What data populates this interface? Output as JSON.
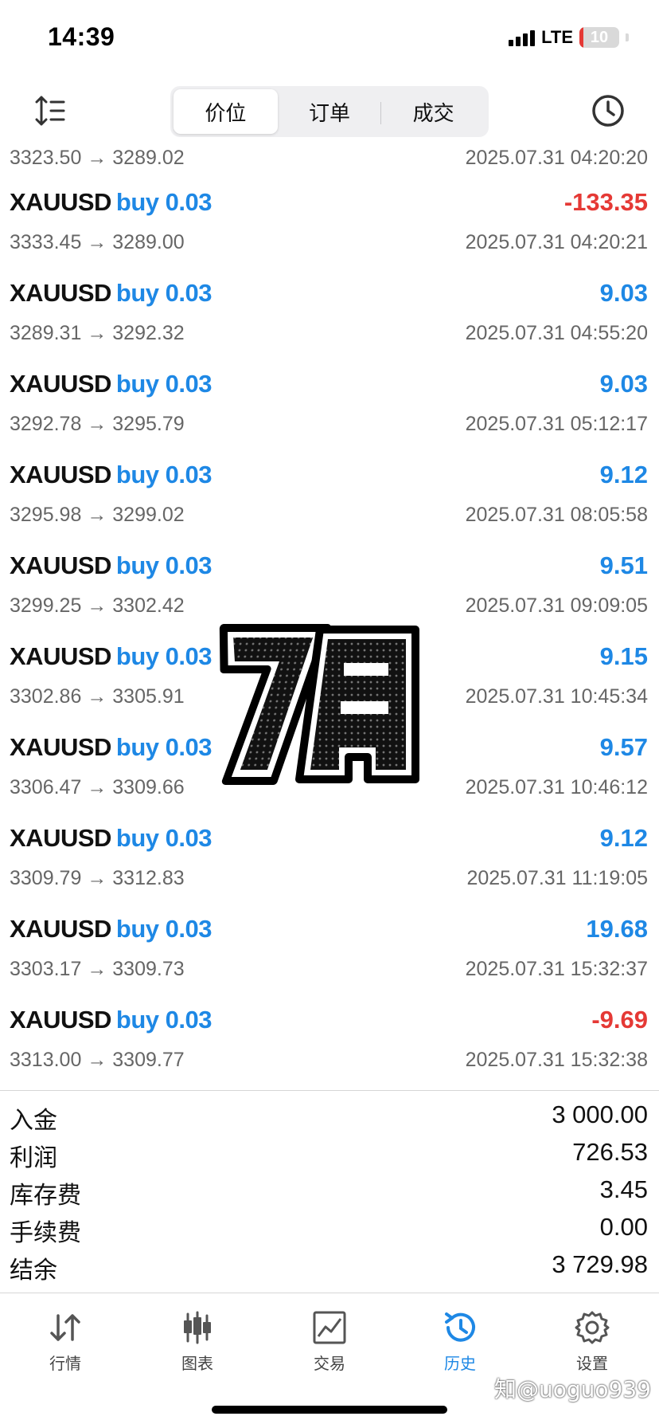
{
  "status": {
    "time": "14:39",
    "network": "LTE",
    "battery": "10"
  },
  "header": {
    "tabs": [
      {
        "label": "价位",
        "active": true
      },
      {
        "label": "订单",
        "active": false
      },
      {
        "label": "成交",
        "active": false
      }
    ]
  },
  "partial_row": {
    "prices": "3323.50 → 3289.02",
    "time": "2025.07.31 04:20:20"
  },
  "deals": [
    {
      "symbol": "XAUUSD",
      "side": "buy 0.03",
      "profit": "-133.35",
      "prices": "3333.45 → 3289.00",
      "time": "2025.07.31 04:20:21"
    },
    {
      "symbol": "XAUUSD",
      "side": "buy 0.03",
      "profit": "9.03",
      "prices": "3289.31 → 3292.32",
      "time": "2025.07.31 04:55:20"
    },
    {
      "symbol": "XAUUSD",
      "side": "buy 0.03",
      "profit": "9.03",
      "prices": "3292.78 → 3295.79",
      "time": "2025.07.31 05:12:17"
    },
    {
      "symbol": "XAUUSD",
      "side": "buy 0.03",
      "profit": "9.12",
      "prices": "3295.98 → 3299.02",
      "time": "2025.07.31 08:05:58"
    },
    {
      "symbol": "XAUUSD",
      "side": "buy 0.03",
      "profit": "9.51",
      "prices": "3299.25 → 3302.42",
      "time": "2025.07.31 09:09:05"
    },
    {
      "symbol": "XAUUSD",
      "side": "buy 0.03",
      "profit": "9.15",
      "prices": "3302.86 → 3305.91",
      "time": "2025.07.31 10:45:34"
    },
    {
      "symbol": "XAUUSD",
      "side": "buy 0.03",
      "profit": "9.57",
      "prices": "3306.47 → 3309.66",
      "time": "2025.07.31 10:46:12"
    },
    {
      "symbol": "XAUUSD",
      "side": "buy 0.03",
      "profit": "9.12",
      "prices": "3309.79 → 3312.83",
      "time": "2025.07.31 11:19:05"
    },
    {
      "symbol": "XAUUSD",
      "side": "buy 0.03",
      "profit": "19.68",
      "prices": "3303.17 → 3309.73",
      "time": "2025.07.31 15:32:37"
    },
    {
      "symbol": "XAUUSD",
      "side": "buy 0.03",
      "profit": "-9.69",
      "prices": "3313.00 → 3309.77",
      "time": "2025.07.31 15:32:38"
    }
  ],
  "summary": [
    {
      "label": "入金",
      "value": "3 000.00"
    },
    {
      "label": "利润",
      "value": "726.53"
    },
    {
      "label": "库存费",
      "value": "3.45"
    },
    {
      "label": "手续费",
      "value": "0.00"
    },
    {
      "label": "结余",
      "value": "3 729.98"
    }
  ],
  "sticker_text": "7月",
  "tabbar": [
    {
      "label": "行情",
      "icon": "quotes-arrows-icon",
      "active": false
    },
    {
      "label": "图表",
      "icon": "candlestick-chart-icon",
      "active": false
    },
    {
      "label": "交易",
      "icon": "trade-chart-icon",
      "active": false
    },
    {
      "label": "历史",
      "icon": "history-clock-icon",
      "active": true
    },
    {
      "label": "设置",
      "icon": "settings-gear-icon",
      "active": false
    }
  ],
  "credit": "知@uoguo939",
  "colors": {
    "accent": "#1e88e5",
    "negative": "#e53935",
    "secondary_text": "#666666"
  }
}
